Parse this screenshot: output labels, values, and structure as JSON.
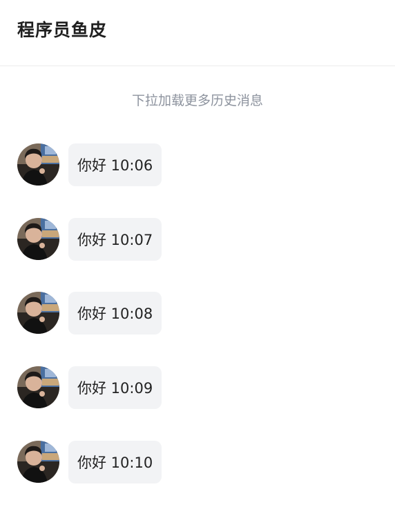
{
  "header": {
    "title": "程序员鱼皮"
  },
  "chat": {
    "load_more": "下拉加载更多历史消息",
    "messages": [
      {
        "text": "你好 10:06",
        "avatar": "avatar-icon"
      },
      {
        "text": "你好 10:07",
        "avatar": "avatar-icon"
      },
      {
        "text": "你好 10:08",
        "avatar": "avatar-icon"
      },
      {
        "text": "你好 10:09",
        "avatar": "avatar-icon"
      },
      {
        "text": "你好 10:10",
        "avatar": "avatar-icon"
      }
    ]
  },
  "colors": {
    "bubble_bg": "#f2f3f5",
    "hint_text": "#8d939e",
    "divider": "#ececec"
  }
}
